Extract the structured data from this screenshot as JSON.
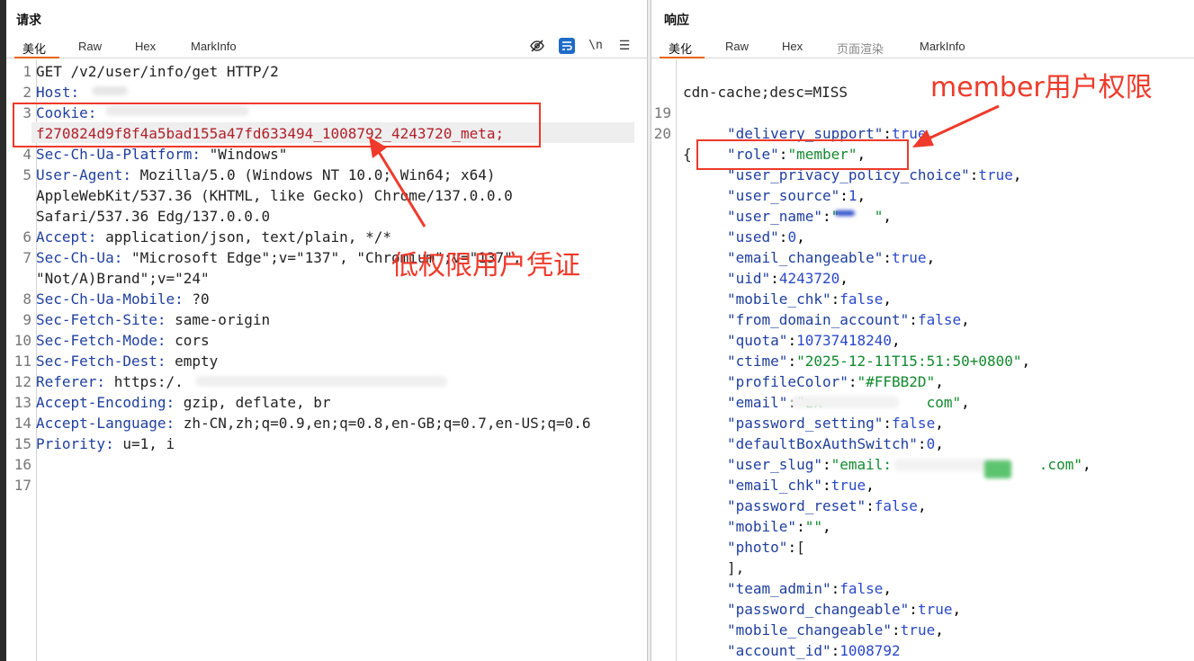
{
  "request": {
    "title": "请求",
    "tabs": [
      {
        "label": "美化",
        "active": true
      },
      {
        "label": "Raw",
        "active": false
      },
      {
        "label": "Hex",
        "active": false
      },
      {
        "label": "MarkInfo",
        "active": false
      }
    ],
    "tools": {
      "eye_off": "eye-off-icon",
      "wrap": "word-wrap-icon",
      "newline": "\\n",
      "menu": "☰"
    },
    "lines": [
      {
        "num": "1",
        "key": "GET /v2/user/info/get HTTP/2",
        "val": ""
      },
      {
        "num": "2",
        "key": "Host:",
        "val": ""
      },
      {
        "num": "3",
        "key": "Cookie:",
        "val": ""
      },
      {
        "num": "",
        "key": "",
        "val": "f270824d9f8f4a5bad155a47fd633494_1008792_4243720_meta;"
      },
      {
        "num": "4",
        "key": "Sec-Ch-Ua-Platform:",
        "val": "\"Windows\""
      },
      {
        "num": "5",
        "key": "User-Agent:",
        "val": "Mozilla/5.0 (Windows NT 10.0; Win64; x64)"
      },
      {
        "num": "",
        "key": "",
        "val": "AppleWebKit/537.36 (KHTML, like Gecko) Chrome/137.0.0.0"
      },
      {
        "num": "",
        "key": "",
        "val": "Safari/537.36 Edg/137.0.0.0"
      },
      {
        "num": "6",
        "key": "Accept:",
        "val": "application/json, text/plain, */*"
      },
      {
        "num": "7",
        "key": "Sec-Ch-Ua:",
        "val": "\"Microsoft Edge\";v=\"137\", \"Chromium\";v=\"137\","
      },
      {
        "num": "",
        "key": "",
        "val": "\"Not/A)Brand\";v=\"24\""
      },
      {
        "num": "8",
        "key": "Sec-Ch-Ua-Mobile:",
        "val": "?0"
      },
      {
        "num": "9",
        "key": "Sec-Fetch-Site:",
        "val": "same-origin"
      },
      {
        "num": "10",
        "key": "Sec-Fetch-Mode:",
        "val": "cors"
      },
      {
        "num": "11",
        "key": "Sec-Fetch-Dest:",
        "val": "empty"
      },
      {
        "num": "12",
        "key": "Referer:",
        "val": "https:/."
      },
      {
        "num": "13",
        "key": "Accept-Encoding:",
        "val": "gzip, deflate, br"
      },
      {
        "num": "14",
        "key": "Accept-Language:",
        "val": "zh-CN,zh;q=0.9,en;q=0.8,en-GB;q=0.7,en-US;q=0.6"
      },
      {
        "num": "15",
        "key": "Priority:",
        "val": "u=1, i"
      },
      {
        "num": "16",
        "key": "",
        "val": ""
      },
      {
        "num": "17",
        "key": "",
        "val": ""
      }
    ],
    "annotation": "低权限用户凭证"
  },
  "response": {
    "title": "响应",
    "tabs": [
      {
        "label": "美化",
        "active": true
      },
      {
        "label": "Raw",
        "active": false
      },
      {
        "label": "Hex",
        "active": false
      },
      {
        "label": "页面渲染",
        "active": false,
        "disabled": true
      },
      {
        "label": "MarkInfo",
        "active": false
      }
    ],
    "header_tail": "cdn-cache;desc=MISS",
    "line19": "19",
    "line20": "20",
    "brace_open": "{",
    "json": [
      {
        "k": "\"delivery_support\"",
        "v": "true",
        "t": "n"
      },
      {
        "k": "\"role\"",
        "v": "\"member\"",
        "t": "s"
      },
      {
        "k": "\"user_privacy_policy_choice\"",
        "v": "true",
        "t": "n"
      },
      {
        "k": "\"user_source\"",
        "v": "1",
        "t": "n"
      },
      {
        "k": "\"user_name\"",
        "v": "\"    \"",
        "t": "s"
      },
      {
        "k": "\"used\"",
        "v": "0",
        "t": "n"
      },
      {
        "k": "\"email_changeable\"",
        "v": "true",
        "t": "n"
      },
      {
        "k": "\"uid\"",
        "v": "4243720",
        "t": "n"
      },
      {
        "k": "\"mobile_chk\"",
        "v": "false",
        "t": "n"
      },
      {
        "k": "\"from_domain_account\"",
        "v": "false",
        "t": "n"
      },
      {
        "k": "\"quota\"",
        "v": "10737418240",
        "t": "n"
      },
      {
        "k": "\"ctime\"",
        "v": "\"2025-12-11T15:51:50+0800\"",
        "t": "s"
      },
      {
        "k": "\"profileColor\"",
        "v": "\"#FFBB2D\"",
        "t": "s"
      },
      {
        "k": "\"email\"",
        "v": "\"zx            com\"",
        "t": "s"
      },
      {
        "k": "\"password_setting\"",
        "v": "false",
        "t": "n"
      },
      {
        "k": "\"defaultBoxAuthSwitch\"",
        "v": "0",
        "t": "n"
      },
      {
        "k": "\"user_slug\"",
        "v": "\"email:                 .com\"",
        "t": "s"
      },
      {
        "k": "\"email_chk\"",
        "v": "true",
        "t": "n"
      },
      {
        "k": "\"password_reset\"",
        "v": "false",
        "t": "n"
      },
      {
        "k": "\"mobile\"",
        "v": "\"\"",
        "t": "s"
      },
      {
        "k": "\"photo\"",
        "v": "[",
        "t": "p"
      },
      {
        "k": "",
        "v": "],",
        "t": "p"
      },
      {
        "k": "\"team_admin\"",
        "v": "false",
        "t": "n"
      },
      {
        "k": "\"password_changeable\"",
        "v": "true",
        "t": "n"
      },
      {
        "k": "\"mobile_changeable\"",
        "v": "true",
        "t": "n"
      },
      {
        "k": "\"account_id\"",
        "v": "1008792",
        "t": "n"
      }
    ],
    "annotation": "member用户权限"
  },
  "colors": {
    "accent": "#e8630a",
    "annotation": "#ee3a2a",
    "key": "#1f3f9e",
    "string": "#138a2e",
    "number": "#2a48c8"
  }
}
